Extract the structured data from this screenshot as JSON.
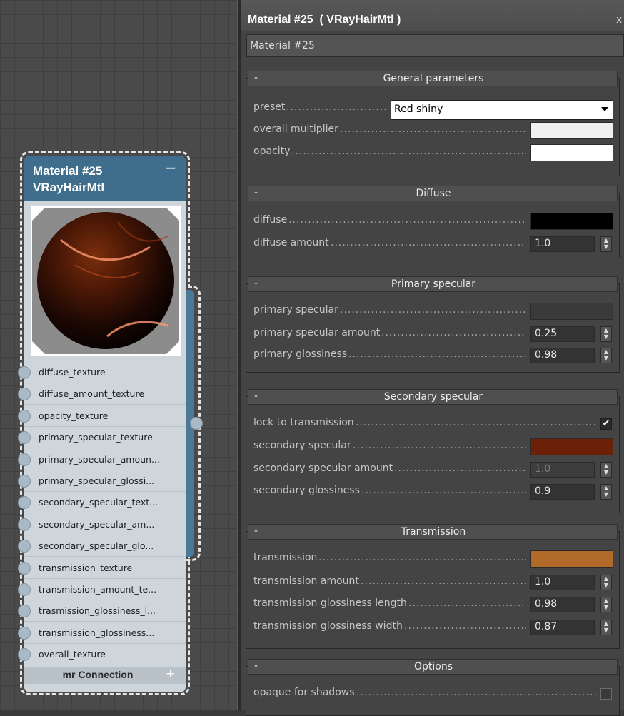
{
  "node": {
    "title_line1": "Material #25",
    "title_line2": "VRayHairMtl",
    "collapse_glyph": "−",
    "slots": [
      "diffuse_texture",
      "diffuse_amount_texture",
      "opacity_texture",
      "primary_specular_texture",
      "primary_specular_amoun...",
      "primary_specular_glossi...",
      "secondary_specular_text...",
      "secondary_specular_am...",
      "secondary_specular_glo...",
      "transmission_texture",
      "transmission_amount_te...",
      "trasmission_glossiness_l...",
      "transmission_glossiness...",
      "overall_texture"
    ],
    "footer_label": "mr Connection",
    "footer_plus": "+"
  },
  "editor": {
    "title": "Material #25  ( VRayHairMtl )",
    "close_glyph": "x",
    "name_value": "Material #25"
  },
  "colors": {
    "node_header": "#3f6e8c",
    "overall_multiplier": "#f0f0f0",
    "opacity": "#ffffff",
    "diffuse": "#000000",
    "primary_specular": "#3a3a3a",
    "secondary_specular": "#6b2108",
    "transmission": "#b26a2a"
  },
  "rollouts": {
    "general": {
      "minus": "-",
      "title": "General parameters",
      "preset_label": "preset",
      "preset_value": "Red shiny",
      "overall_multiplier_label": "overall multiplier",
      "opacity_label": "opacity"
    },
    "diffuse": {
      "minus": "-",
      "title": "Diffuse",
      "diffuse_label": "diffuse",
      "diffuse_amount_label": "diffuse amount",
      "diffuse_amount_value": "1.0"
    },
    "primary": {
      "minus": "-",
      "title": "Primary specular",
      "specular_label": "primary specular",
      "amount_label": "primary specular amount",
      "amount_value": "0.25",
      "gloss_label": "primary glossiness",
      "gloss_value": "0.98"
    },
    "secondary": {
      "minus": "-",
      "title": "Secondary specular",
      "lock_label": "lock to transmission",
      "lock_checked": "✔",
      "specular_label": "secondary specular",
      "amount_label": "secondary specular amount",
      "amount_value": "1.0",
      "gloss_label": "secondary glossiness",
      "gloss_value": "0.9"
    },
    "transmission": {
      "minus": "-",
      "title": "Transmission",
      "transmission_label": "transmission",
      "amount_label": "transmission amount",
      "amount_value": "1.0",
      "gloss_length_label": "transmission glossiness length",
      "gloss_length_value": "0.98",
      "gloss_width_label": "transmission glossiness width",
      "gloss_width_value": "0.87"
    },
    "options": {
      "minus": "-",
      "title": "Options",
      "opaque_label": "opaque for shadows"
    }
  }
}
